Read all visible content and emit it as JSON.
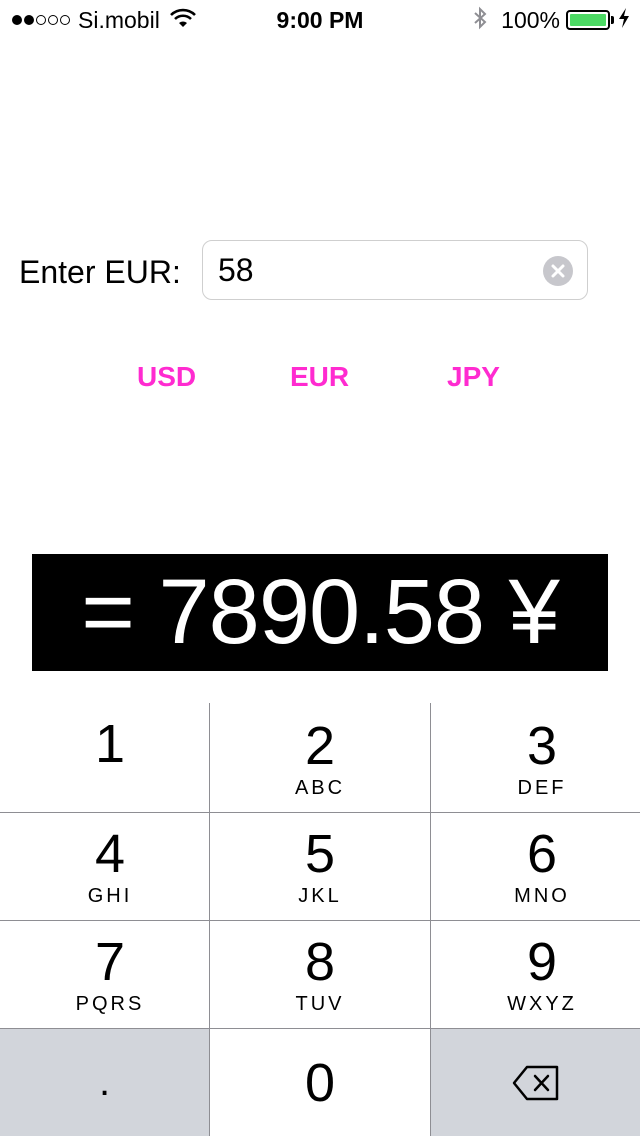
{
  "status_bar": {
    "carrier": "Si.mobil",
    "time": "9:00 PM",
    "battery_percent": "100%",
    "signal_bars_filled": 2,
    "signal_bars_total": 5,
    "battery_level": 1.0,
    "battery_color": "#4cd964"
  },
  "converter": {
    "input_label": "Enter EUR:",
    "input_value": "58",
    "currency_buttons": [
      "USD",
      "EUR",
      "JPY"
    ],
    "accent_color": "#ff2bd0",
    "result": "= 7890.58 ¥"
  },
  "keypad": {
    "keys": [
      {
        "digit": "1",
        "letters": ""
      },
      {
        "digit": "2",
        "letters": "ABC"
      },
      {
        "digit": "3",
        "letters": "DEF"
      },
      {
        "digit": "4",
        "letters": "GHI"
      },
      {
        "digit": "5",
        "letters": "JKL"
      },
      {
        "digit": "6",
        "letters": "MNO"
      },
      {
        "digit": "7",
        "letters": "PQRS"
      },
      {
        "digit": "8",
        "letters": "TUV"
      },
      {
        "digit": "9",
        "letters": "WXYZ"
      }
    ],
    "decimal": ".",
    "zero": "0",
    "delete_icon": "backspace-icon"
  }
}
